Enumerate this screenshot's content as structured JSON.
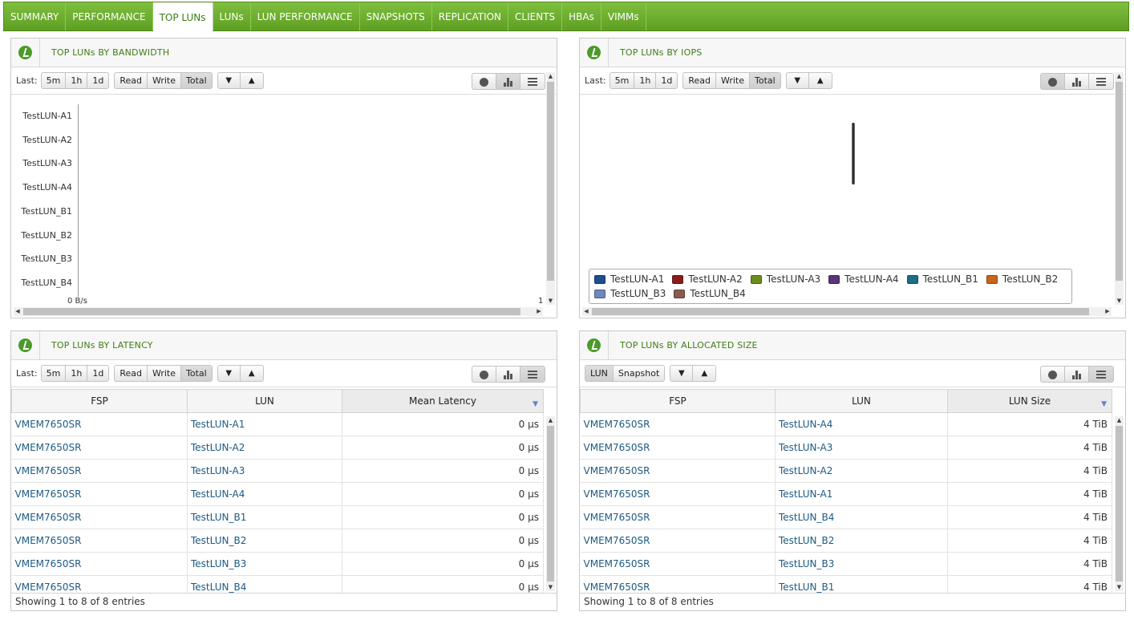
{
  "tabs": [
    {
      "label": "SUMMARY",
      "active": false
    },
    {
      "label": "PERFORMANCE",
      "active": false
    },
    {
      "label": "TOP LUNs",
      "active": true
    },
    {
      "label": "LUNs",
      "active": false
    },
    {
      "label": "LUN PERFORMANCE",
      "active": false
    },
    {
      "label": "SNAPSHOTS",
      "active": false
    },
    {
      "label": "REPLICATION",
      "active": false
    },
    {
      "label": "CLIENTS",
      "active": false
    },
    {
      "label": "HBAs",
      "active": false
    },
    {
      "label": "VIMMs",
      "active": false
    }
  ],
  "time_controls": {
    "last_label": "Last:",
    "ranges": [
      "5m",
      "1h",
      "1d"
    ],
    "modes": [
      "Read",
      "Write",
      "Total"
    ],
    "active_mode": "Total",
    "sort_down": "▼",
    "sort_up": "▲"
  },
  "bandwidth": {
    "title": "TOP LUNs BY BANDWIDTH",
    "chart_data": {
      "type": "bar",
      "categories": [
        "TestLUN-A1",
        "TestLUN-A2",
        "TestLUN-A3",
        "TestLUN-A4",
        "TestLUN_B1",
        "TestLUN_B2",
        "TestLUN_B3",
        "TestLUN_B4"
      ],
      "values": [
        0,
        0,
        0,
        0,
        0,
        0,
        0,
        0
      ],
      "x_tick_start": "0 B/s",
      "x_tick_end": "1"
    }
  },
  "iops": {
    "title": "TOP LUNs BY IOPS",
    "chart_data": {
      "type": "pie",
      "series": [
        {
          "name": "TestLUN-A1",
          "color": "#1f4e8c"
        },
        {
          "name": "TestLUN-A2",
          "color": "#8b1c1c"
        },
        {
          "name": "TestLUN-A3",
          "color": "#6a8c1c"
        },
        {
          "name": "TestLUN-A4",
          "color": "#5b3478"
        },
        {
          "name": "TestLUN_B1",
          "color": "#1c6e86"
        },
        {
          "name": "TestLUN_B2",
          "color": "#c8661c"
        },
        {
          "name": "TestLUN_B3",
          "color": "#6f86bf"
        },
        {
          "name": "TestLUN_B4",
          "color": "#8a5a50"
        }
      ]
    }
  },
  "latency": {
    "title": "TOP LUNs BY LATENCY",
    "columns": [
      "FSP",
      "LUN",
      "Mean Latency"
    ],
    "rows": [
      {
        "fsp": "VMEM7650SR",
        "lun": "TestLUN-A1",
        "value": "0 µs"
      },
      {
        "fsp": "VMEM7650SR",
        "lun": "TestLUN-A2",
        "value": "0 µs"
      },
      {
        "fsp": "VMEM7650SR",
        "lun": "TestLUN-A3",
        "value": "0 µs"
      },
      {
        "fsp": "VMEM7650SR",
        "lun": "TestLUN-A4",
        "value": "0 µs"
      },
      {
        "fsp": "VMEM7650SR",
        "lun": "TestLUN_B1",
        "value": "0 µs"
      },
      {
        "fsp": "VMEM7650SR",
        "lun": "TestLUN_B2",
        "value": "0 µs"
      },
      {
        "fsp": "VMEM7650SR",
        "lun": "TestLUN_B3",
        "value": "0 µs"
      },
      {
        "fsp": "VMEM7650SR",
        "lun": "TestLUN_B4",
        "value": "0 µs"
      }
    ],
    "footer": "Showing 1 to 8 of 8 entries"
  },
  "allocated": {
    "title": "TOP LUNs BY ALLOCATED SIZE",
    "type_buttons": [
      "LUN",
      "Snapshot"
    ],
    "columns": [
      "FSP",
      "LUN",
      "LUN Size"
    ],
    "rows": [
      {
        "fsp": "VMEM7650SR",
        "lun": "TestLUN-A4",
        "value": "4 TiB"
      },
      {
        "fsp": "VMEM7650SR",
        "lun": "TestLUN-A3",
        "value": "4 TiB"
      },
      {
        "fsp": "VMEM7650SR",
        "lun": "TestLUN-A2",
        "value": "4 TiB"
      },
      {
        "fsp": "VMEM7650SR",
        "lun": "TestLUN-A1",
        "value": "4 TiB"
      },
      {
        "fsp": "VMEM7650SR",
        "lun": "TestLUN_B4",
        "value": "4 TiB"
      },
      {
        "fsp": "VMEM7650SR",
        "lun": "TestLUN_B2",
        "value": "4 TiB"
      },
      {
        "fsp": "VMEM7650SR",
        "lun": "TestLUN_B3",
        "value": "4 TiB"
      },
      {
        "fsp": "VMEM7650SR",
        "lun": "TestLUN_B1",
        "value": "4 TiB"
      }
    ],
    "footer": "Showing 1 to 8 of 8 entries"
  }
}
